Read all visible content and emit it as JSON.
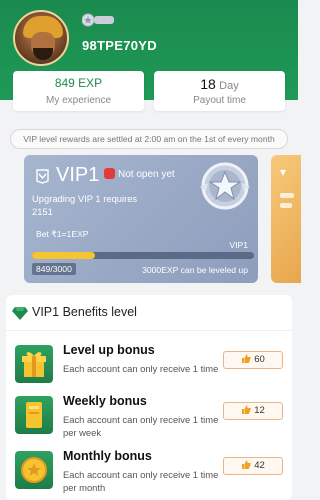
{
  "profile": {
    "uid": "98TPE70YD",
    "avatar_icon": "avatar-portrait",
    "vip_badge_icon": "vip-badge-icon"
  },
  "stats": {
    "experience_value": "849 EXP",
    "experience_label": "My experience",
    "payout_value": "18",
    "payout_unit": "Day",
    "payout_label": "Payout time"
  },
  "notice": "VIP level rewards are settled at 2:00 am on the 1st of every month",
  "vip_card": {
    "level": "VIP1",
    "status": "Not open yet",
    "requirement_line1": "Upgrading VIP 1 requires",
    "requirement_line2": "2151",
    "bet_rate": "Bet ₹1=1EXP",
    "level_right": "VIP1",
    "progress_current": 849,
    "progress_total": 3000,
    "progress_text": "849/3000",
    "progress_hint": "3000EXP can be leveled up",
    "colors": {
      "card": "#9aaac6",
      "progress": "#f5c430"
    }
  },
  "benefits": {
    "header": "VIP1 Benefits level",
    "items": [
      {
        "title": "Level up bonus",
        "desc": "Each account can only receive 1 time",
        "reward": "60",
        "icon": "gift-icon"
      },
      {
        "title": "Weekly bonus",
        "desc": "Each account can only receive 1 time per week",
        "reward": "12",
        "icon": "coupon-icon"
      },
      {
        "title": "Monthly bonus",
        "desc": "Each account can only receive 1 time per month",
        "reward": "42",
        "icon": "coin-icon"
      }
    ]
  },
  "colors": {
    "brand_green": "#1f8a4c",
    "reward_border": "#e9b48a"
  }
}
